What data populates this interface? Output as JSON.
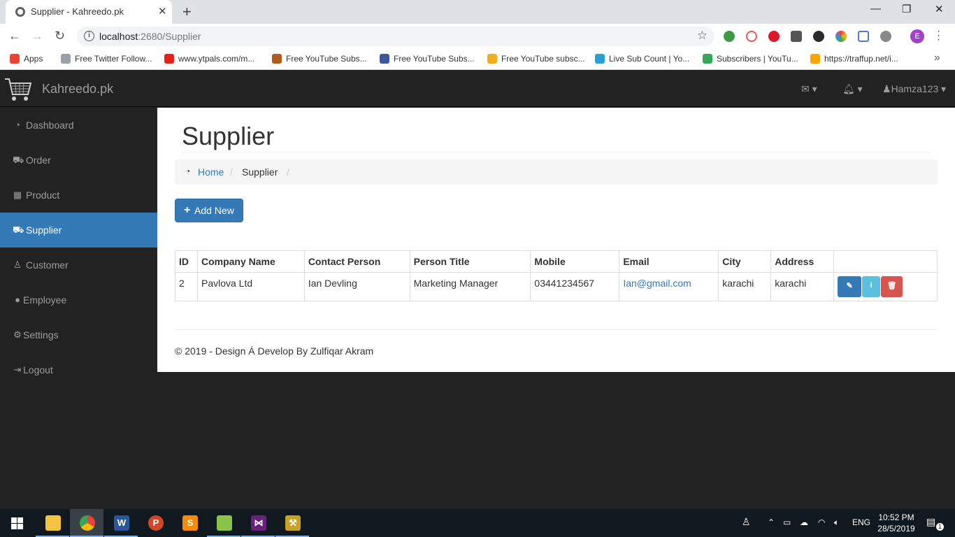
{
  "browser": {
    "tab_title": "Supplier - Kahreedo.pk",
    "url_host": "localhost",
    "url_rest": ":2680/Supplier",
    "profile_initial": "E",
    "bookmarks": [
      {
        "label": "Apps",
        "color": "#ea4335"
      },
      {
        "label": "Free Twitter Follow...",
        "color": "#9aa0a6"
      },
      {
        "label": "www.ytpals.com/m...",
        "color": "#e62117"
      },
      {
        "label": "Free YouTube Subs...",
        "color": "#b35a1f"
      },
      {
        "label": "Free YouTube Subs...",
        "color": "#3b5998"
      },
      {
        "label": "Free YouTube subsc...",
        "color": "#f2b01e"
      },
      {
        "label": "Live Sub Count | Yo...",
        "color": "#2a9fd6"
      },
      {
        "label": "Subscribers | YouTu...",
        "color": "#34a853"
      },
      {
        "label": "https://traffup.net/i...",
        "color": "#f7a600"
      }
    ]
  },
  "app": {
    "brand": "Kahreedo.pk",
    "user": "Hamza123",
    "sidebar": [
      {
        "label": "Dashboard",
        "icon": "dashboard-icon",
        "glyph": "◔"
      },
      {
        "label": "Order",
        "icon": "cart-icon",
        "glyph": "⛟"
      },
      {
        "label": "Product",
        "icon": "grid-icon",
        "glyph": "▦"
      },
      {
        "label": "Supplier",
        "icon": "truck-icon",
        "glyph": "⛟"
      },
      {
        "label": "Customer",
        "icon": "person-icon",
        "glyph": "♙"
      },
      {
        "label": "Employee",
        "icon": "user-icon",
        "glyph": "●"
      },
      {
        "label": "Settings",
        "icon": "gear-icon",
        "glyph": "⚙"
      },
      {
        "label": "Logout",
        "icon": "logout-icon",
        "glyph": "⇥"
      }
    ],
    "active_item": "Supplier",
    "page_title": "Supplier",
    "breadcrumb": {
      "home": "Home",
      "sep": "/",
      "current": "Supplier"
    },
    "add_button": "Add New",
    "table": {
      "headers": [
        "ID",
        "Company Name",
        "Contact Person",
        "Person Title",
        "Mobile",
        "Email",
        "City",
        "Address",
        ""
      ],
      "rows": [
        {
          "id": "2",
          "company": "Pavlova Ltd",
          "contact": "Ian Devling",
          "title": "Marketing Manager",
          "mobile": "03441234567",
          "email": "Ian@gmail.com",
          "city": "karachi",
          "address": "karachi"
        }
      ]
    },
    "footer": "© 2019 - Design Á Develop By Zulfiqar Akram"
  },
  "taskbar": {
    "lang": "ENG",
    "time": "10:52 PM",
    "date": "28/5/2019",
    "notification_count": "1"
  }
}
